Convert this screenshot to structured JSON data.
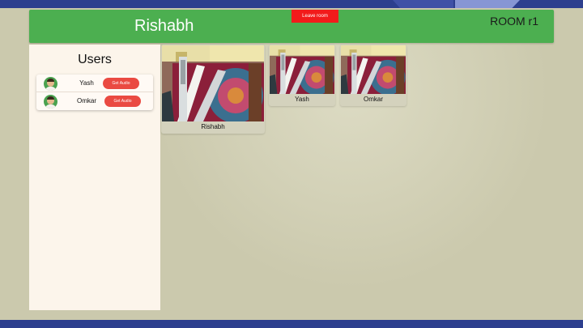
{
  "header": {
    "username": "Rishabh",
    "room_label": "ROOM r1",
    "leave_button": "Leave room",
    "accent": "#4caf50"
  },
  "sidebar": {
    "title": "Users",
    "users": [
      {
        "name": "Yash",
        "action": "Get Audio"
      },
      {
        "name": "Omkar",
        "action": "Get Audio"
      }
    ]
  },
  "videos": [
    {
      "name": "Rishabh"
    },
    {
      "name": "Yash"
    },
    {
      "name": "Omkar"
    }
  ],
  "colors": {
    "background": "#cbc9ad",
    "leave_button": "#f21b1b",
    "audio_button": "#ea4a42",
    "frame": "#2d3f8e"
  },
  "icons": [
    "avatar-icon"
  ]
}
